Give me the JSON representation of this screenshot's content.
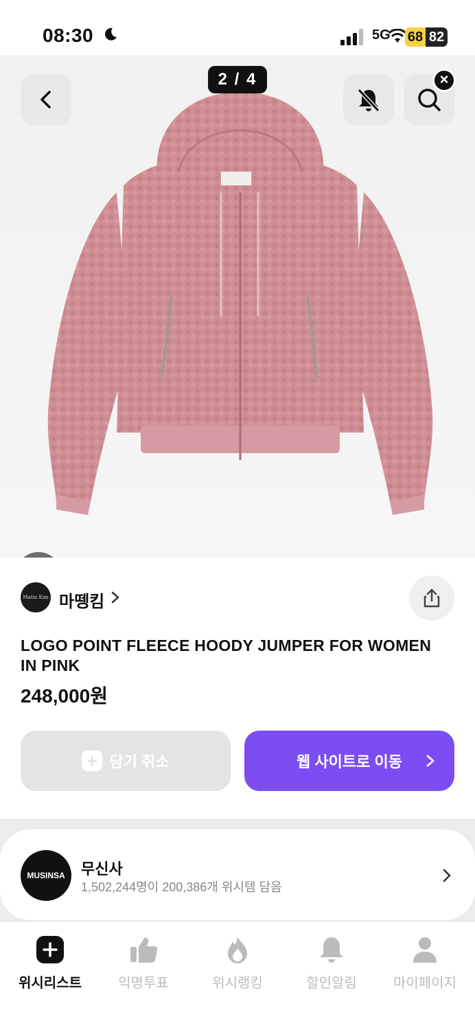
{
  "status_bar": {
    "time": "08:30",
    "network": "5G",
    "battery": "68",
    "battery_alt": "82"
  },
  "gallery": {
    "page_indicator": "2 / 4",
    "close_symbol": "×",
    "product_color": "#cf8e93"
  },
  "product": {
    "brand_logo_text": "Matin Kim",
    "brand_name": "마뗑킴",
    "title": "LOGO POINT FLEECE HOODY JUMPER FOR WOMEN IN PINK",
    "price": "248,000원"
  },
  "actions": {
    "cancel_label": "담기 취소",
    "cancel_plus": "+",
    "web_label": "웹 사이트로 이동",
    "accent_color": "#7b4df2"
  },
  "store": {
    "logo_text": "MUSINSA",
    "name": "무신사",
    "stats": "1,502,244명이 200,386개 위시템 담음"
  },
  "tabs": [
    {
      "label": "위시리스트",
      "icon": "plus-icon",
      "active": true
    },
    {
      "label": "익명투표",
      "icon": "thumbs-up-icon",
      "active": false
    },
    {
      "label": "위시랭킹",
      "icon": "fire-icon",
      "active": false
    },
    {
      "label": "할인알림",
      "icon": "bell-icon",
      "active": false
    },
    {
      "label": "마이페이지",
      "icon": "person-icon",
      "active": false
    }
  ]
}
